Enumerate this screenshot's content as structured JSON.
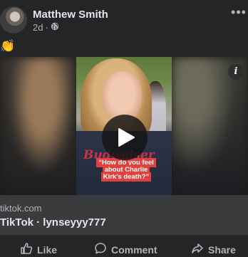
{
  "post": {
    "author": "Matthew Smith",
    "time": "2d",
    "separator": "·",
    "privacy_icon": "globe-icon",
    "more_icon": "more-horizontal-icon",
    "message": "👏"
  },
  "video": {
    "caption": "“How do you feel about Charlie Kirk’s death?”",
    "shirt_text": "Budweiser",
    "play_icon": "play-icon",
    "info_icon": "info-icon",
    "info_label": "i"
  },
  "link": {
    "domain": "tiktok.com",
    "title": "TikTok · lynseyyy777"
  },
  "actions": {
    "like": "Like",
    "comment": "Comment",
    "share": "Share"
  }
}
